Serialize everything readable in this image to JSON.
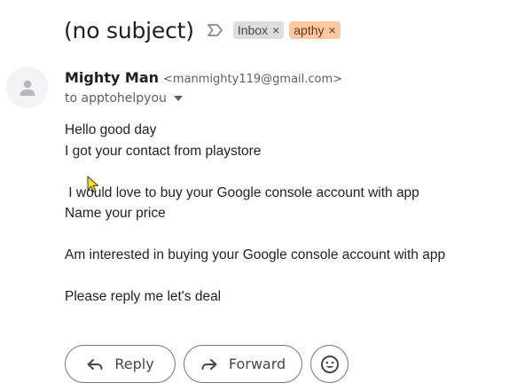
{
  "email": {
    "subject": "(no subject)",
    "labels": [
      {
        "name": "Inbox",
        "close": "×",
        "color": "#dddddd"
      },
      {
        "name": "apthy",
        "close": "×",
        "color": "#ffc8a0"
      }
    ],
    "sender": {
      "name": "Mighty Man",
      "email": "<manmighty119@gmail.com>"
    },
    "recipient_line": "to apptohelpyou",
    "body_lines": [
      "Hello good day",
      "I got your contact from playstore",
      "",
      " I would love to buy your Google console account with app",
      "Name your price",
      "",
      "Am interested in buying your Google console account with app",
      "",
      "Please reply me let's deal"
    ]
  },
  "actions": {
    "reply_label": "Reply",
    "forward_label": "Forward"
  },
  "icons": {
    "important": "label-important-outline-icon",
    "avatar": "person-avatar-icon",
    "recipient_toggle": "caret-down-icon",
    "reply": "reply-arrow-icon",
    "forward": "forward-arrow-icon",
    "emoji": "emoji-smiley-icon",
    "cursor": "mouse-pointer-icon"
  },
  "colors": {
    "inbox_chip": "#dddddd",
    "apthy_chip": "#ffc8a0",
    "cursor": "#f5e21b"
  }
}
